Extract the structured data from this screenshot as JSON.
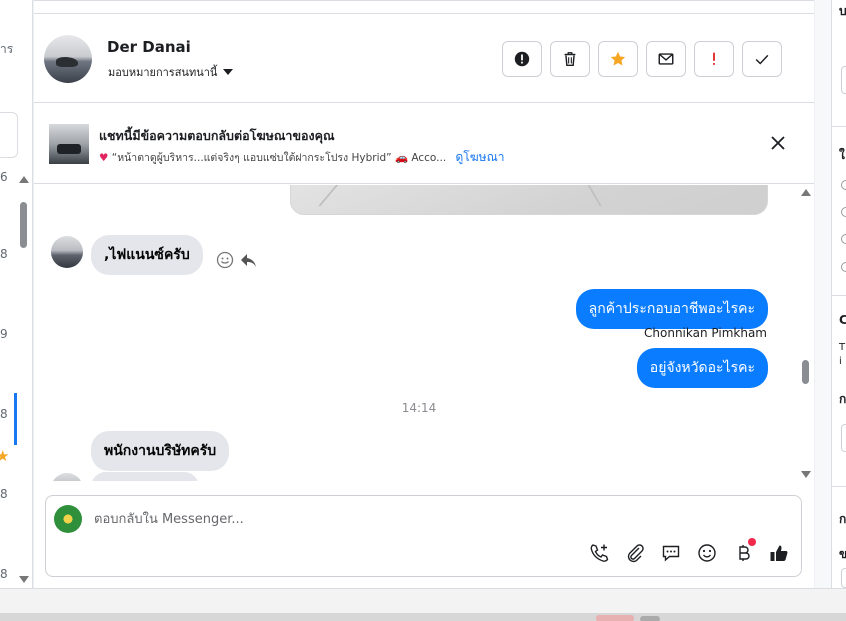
{
  "left_col": {
    "label_top": "าร",
    "row_nums": [
      "6",
      "8",
      "9",
      "8",
      "8",
      "8"
    ]
  },
  "header": {
    "name": "Der Danai",
    "assign_label": "มอบหมายการสนทนานี้"
  },
  "actions": [
    {
      "icon": "exclamation-circle-icon",
      "label": "Mark as spam"
    },
    {
      "icon": "trash-icon",
      "label": "Delete"
    },
    {
      "icon": "star-icon",
      "label": "Star"
    },
    {
      "icon": "envelope-icon",
      "label": "Mark as unread"
    },
    {
      "icon": "exclamation-icon",
      "label": "Follow up"
    },
    {
      "icon": "check-icon",
      "label": "Mark as done"
    }
  ],
  "ad": {
    "title": "แชทนี้มีข้อความตอบกลับต่อโฆษณาของคุณ",
    "subtitle": "“หน้าตาดูผู้บริหาร...แต่จริงๆ แอบแซ่บใต้ฝากระโปรง Hybrid”",
    "subtitle_tail": "Acco...",
    "link": "ดูโฆษณา"
  },
  "messages": {
    "in1": ",ไฟแนนซ์ครับ",
    "out1": "ลูกค้าประกอบอาชีพอะไรคะ",
    "sender": "Chonnikan Pimkham",
    "out2": "อยู่จังหวัดอะไรคะ",
    "time": "14:14",
    "in2": "พนักงานบริษัทครับ"
  },
  "composer": {
    "placeholder": "ตอบกลับใน Messenger..."
  },
  "right_col": {
    "texts": [
      "บ",
      "ใ",
      "C",
      "T",
      "i",
      "ก",
      "ก",
      "ข"
    ]
  },
  "colors": {
    "accent": "#1877f2",
    "bubble_out": "#0a7cff",
    "bubble_in": "#e4e6eb",
    "star": "#f5a623",
    "followup": "#e02020",
    "notification_dot": "#f02849"
  }
}
